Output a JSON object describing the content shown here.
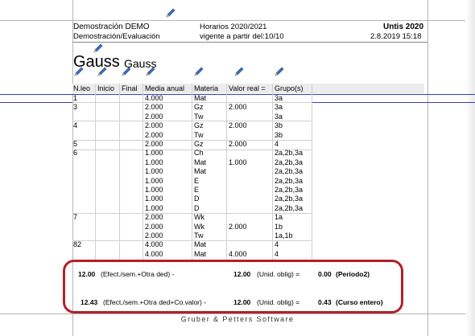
{
  "header": {
    "school_name": "Demostración  DEMO",
    "school_subtitle": "Demostración/Evaluación",
    "schedule_name": "Horarios 2020/2021",
    "valid_from": "vigente a partir del:10/10",
    "app_name": "Untis 2020",
    "date_time": "2.8.2019  15:18"
  },
  "teacher": {
    "name_large": "Gauss",
    "name_small": "Gauss"
  },
  "table": {
    "columns": [
      "N.leo",
      "Inicio",
      "Final",
      "Media anual",
      "Materia",
      "Valor real =",
      "Grupo(s)"
    ],
    "rows": [
      {
        "nleo": "1",
        "media": "4.000",
        "materia": "Mat",
        "valor": "",
        "grupo": "3a"
      },
      {
        "nleo": "3",
        "media": "2.000",
        "materia": "Gz",
        "valor": "2.000",
        "grupo": "3a"
      },
      {
        "nleo": "",
        "media": "2.000",
        "materia": "Tw",
        "valor": "",
        "grupo": "3a"
      },
      {
        "nleo": "4",
        "media": "2.000",
        "materia": "Gz",
        "valor": "2.000",
        "grupo": "3b"
      },
      {
        "nleo": "",
        "media": "2.000",
        "materia": "Tw",
        "valor": "",
        "grupo": "3b"
      },
      {
        "nleo": "5",
        "media": "2.000",
        "materia": "Gz",
        "valor": "2.000",
        "grupo": "4"
      },
      {
        "nleo": "6",
        "media": "1.000",
        "materia": "Ch",
        "valor": "",
        "grupo": "2a,2b,3a"
      },
      {
        "nleo": "",
        "media": "1.000",
        "materia": "Mat",
        "valor": "1.000",
        "grupo": "2a,2b,3a"
      },
      {
        "nleo": "",
        "media": "1.000",
        "materia": "Mat",
        "valor": "",
        "grupo": "2a,2b,3a"
      },
      {
        "nleo": "",
        "media": "1.000",
        "materia": "E",
        "valor": "",
        "grupo": "2a,2b,3a"
      },
      {
        "nleo": "",
        "media": "1.000",
        "materia": "E",
        "valor": "",
        "grupo": "2a,2b,3a"
      },
      {
        "nleo": "",
        "media": "1.000",
        "materia": "D",
        "valor": "",
        "grupo": "2a,2b,3a"
      },
      {
        "nleo": "",
        "media": "1.000",
        "materia": "D",
        "valor": "",
        "grupo": "2a,2b,3a"
      },
      {
        "nleo": "7",
        "media": "2.000",
        "materia": "Wk",
        "valor": "",
        "grupo": "1a"
      },
      {
        "nleo": "",
        "media": "2.000",
        "materia": "Wk",
        "valor": "2.000",
        "grupo": "1b"
      },
      {
        "nleo": "",
        "media": "2.000",
        "materia": "Tw",
        "valor": "",
        "grupo": "1a,1b"
      },
      {
        "nleo": "82",
        "media": "4.000",
        "materia": "Mat",
        "valor": "",
        "grupo": "4"
      },
      {
        "nleo": "",
        "media": "4.000",
        "materia": "Mat",
        "valor": "4.000",
        "grupo": "4"
      }
    ]
  },
  "summary": {
    "line1": {
      "value": "12.00",
      "label": "(Efect./sem.+Otra ded) -",
      "oblig_value": "12.00",
      "oblig_label": "(Unid. oblig) =",
      "result": "0.00",
      "result_label": "(Período2)"
    },
    "line2": {
      "value": "12.43",
      "label": "(Efect./sem.+Otra ded+Co.valor) -",
      "oblig_value": "12.00",
      "oblig_label": "(Unid. oblig) =",
      "result": "0.43",
      "result_label": "(Curso entero)"
    }
  },
  "footer": "Gruber & Petters Software",
  "colors": {
    "highlight": "#b2202b",
    "selection_line": "#3a3ad0",
    "header_bg": "#ececec"
  }
}
